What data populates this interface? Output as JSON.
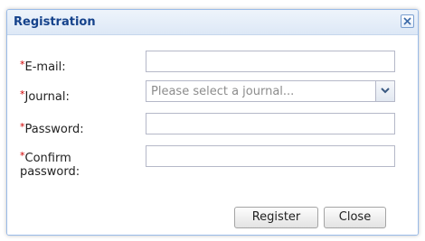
{
  "dialog": {
    "title": "Registration",
    "close_glyph": "✕"
  },
  "form": {
    "required_marker": "*",
    "email_label": "E-mail:",
    "journal_label": "Journal:",
    "journal_placeholder": "Please select a journal...",
    "password_label": "Password:",
    "confirm_label_line1": "Confirm",
    "confirm_label_line2": "password:"
  },
  "buttons": {
    "register": "Register",
    "close": "Close"
  },
  "icons": {
    "close": "close-icon",
    "dropdown": "chevron-down-icon"
  },
  "colors": {
    "title_text": "#15428b",
    "required_marker": "#d00000",
    "border_accent": "#99bbe8"
  }
}
